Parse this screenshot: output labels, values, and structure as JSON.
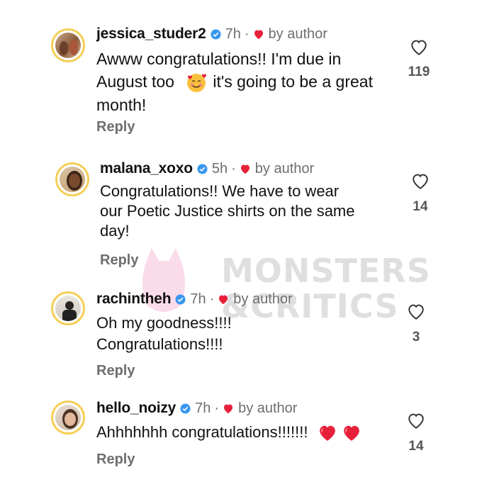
{
  "comments": [
    {
      "username": "jessica_studer2",
      "time": "7h",
      "dot": "·",
      "by_author": "by author",
      "text_lines": [
        "Awww congratulations!! I'm due in",
        "August too",
        "it's going to be a great",
        "month!"
      ],
      "reply": "Reply",
      "likes": "119",
      "avatar_icon": "user-avatar-couple"
    },
    {
      "username": "malana_xoxo",
      "time": "5h",
      "dot": "·",
      "by_author": "by author",
      "text_lines": [
        "Congratulations!! We have to wear",
        "our Poetic Justice shirts on the same",
        "day!"
      ],
      "reply": "Reply",
      "likes": "14",
      "avatar_icon": "user-avatar-woman"
    },
    {
      "username": "rachintheh",
      "time": "7h",
      "dot": "·",
      "by_author": "by author",
      "text_lines": [
        "Oh my goodness!!!!",
        "Congratulations!!!!"
      ],
      "reply": "Reply",
      "likes": "3",
      "avatar_icon": "user-avatar-man"
    },
    {
      "username": "hello_noizy",
      "time": "7h",
      "dot": "·",
      "by_author": "by author",
      "text_lines": [
        "Ahhhhhhh congratulations!!!!!!!"
      ],
      "reply": "Reply",
      "likes": "14",
      "avatar_icon": "user-avatar-woman-smile"
    }
  ],
  "watermark": {
    "line1": "MONSTERS",
    "line2": "&CRITICS"
  },
  "colors": {
    "heart_red": "#e8213a",
    "verified_blue": "#3897f0",
    "ring": "#f5cf57",
    "muted": "#6e6e6e"
  }
}
